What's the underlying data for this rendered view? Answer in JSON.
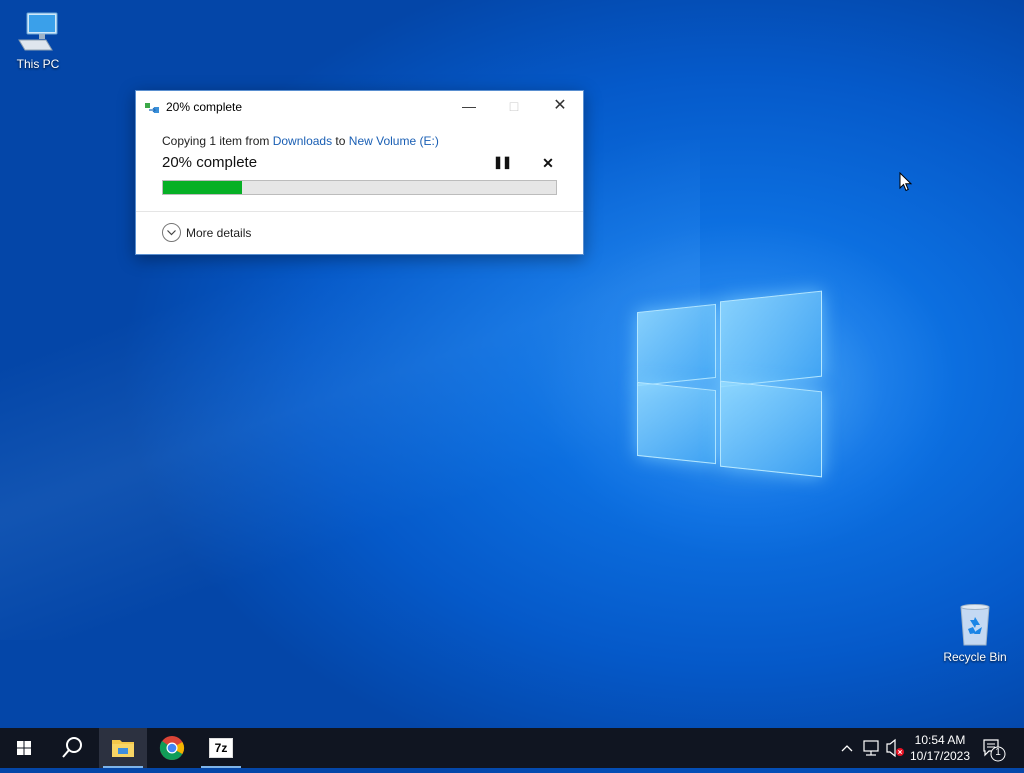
{
  "desktop": {
    "icons": [
      {
        "label": "This PC",
        "icon": "this-pc-icon"
      },
      {
        "label": "Recycle Bin",
        "icon": "recycle-bin-icon"
      }
    ]
  },
  "dialog": {
    "title": "20% complete",
    "copy_prefix": "Copying 1 item from ",
    "source": "Downloads",
    "copy_mid": " to ",
    "destination": "New Volume (E:)",
    "status": "20% complete",
    "progress": 0.2,
    "more_details": "More details",
    "colors": {
      "progress_fill": "#06b025",
      "link": "#1a5fb4"
    }
  },
  "taskbar": {
    "apps": [
      {
        "name": "start",
        "icon": "windows-start-icon"
      },
      {
        "name": "search",
        "icon": "search-icon"
      },
      {
        "name": "file-explorer",
        "icon": "folder-icon",
        "active": true
      },
      {
        "name": "chrome",
        "icon": "chrome-icon"
      },
      {
        "name": "7-zip",
        "icon": "7zip-icon",
        "label": "7z"
      }
    ],
    "clock": {
      "time": "10:54 AM",
      "date": "10/17/2023"
    },
    "notification_count": "1"
  }
}
